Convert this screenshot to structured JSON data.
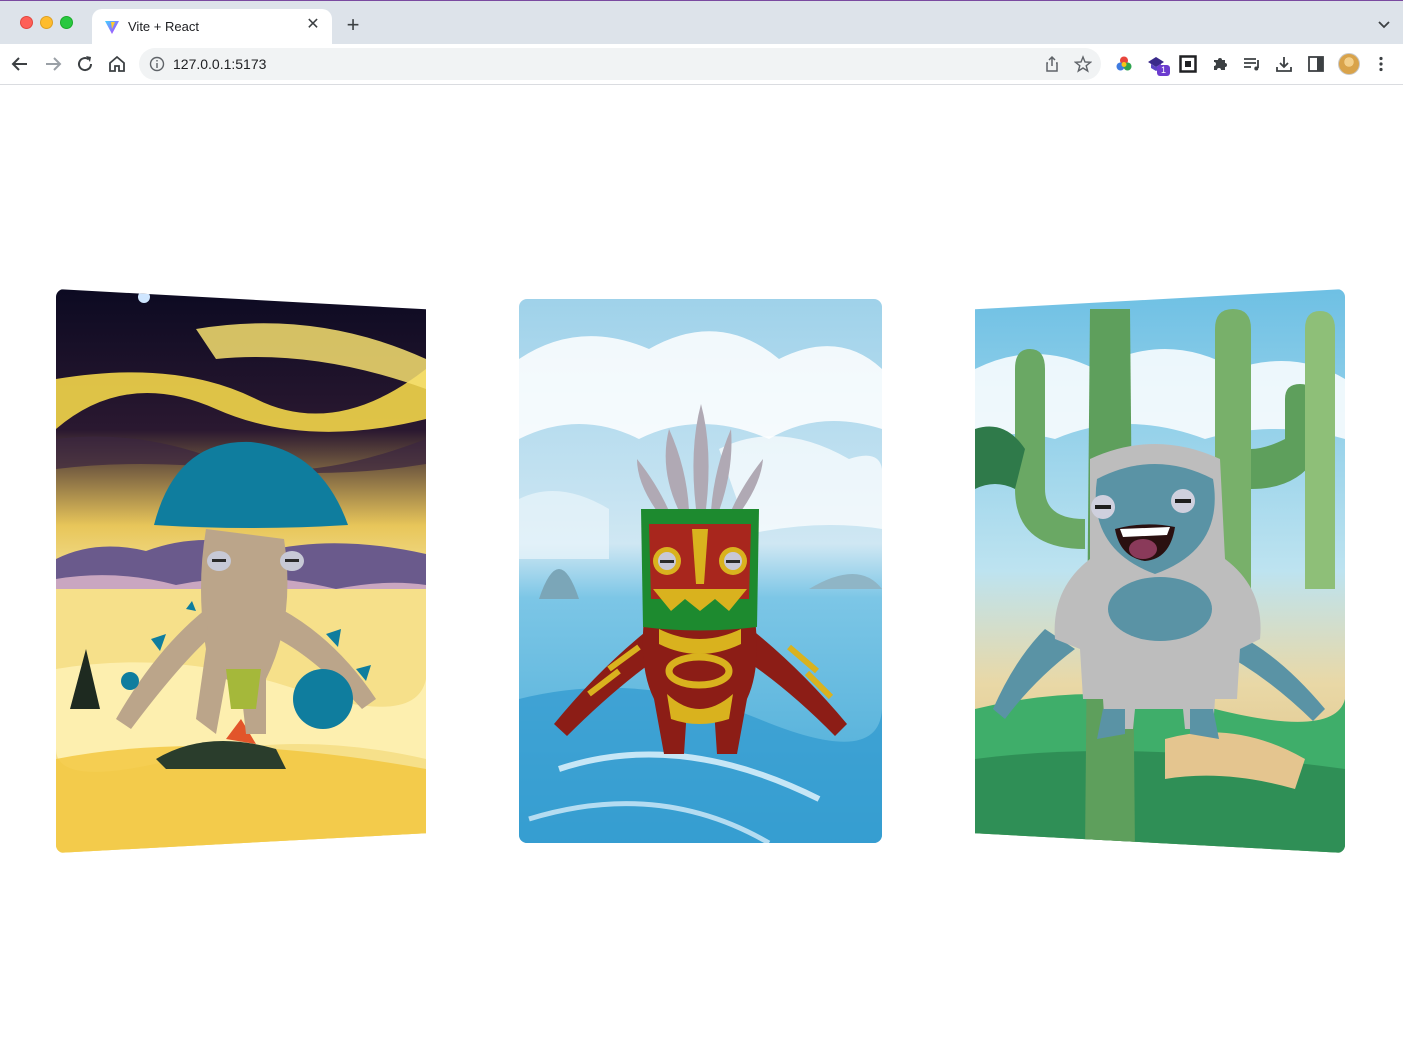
{
  "browser": {
    "tab": {
      "title": "Vite + React",
      "favicon": "vite-logo-icon",
      "close_icon": "close-icon"
    },
    "new_tab_icon": "plus-icon",
    "tab_search_icon": "chevron-down-icon",
    "nav": {
      "back": "arrow-left-icon",
      "forward": "arrow-right-icon",
      "reload": "reload-icon",
      "home": "home-icon"
    },
    "address_bar": {
      "url": "127.0.0.1:5173",
      "info_icon": "info-icon",
      "share_icon": "share-icon",
      "bookmark_icon": "star-icon"
    },
    "extensions": {
      "items": [
        "color-wheel-icon",
        "gem-extension-icon",
        "frame-extension-icon",
        "puzzle-icon",
        "media-queue-icon",
        "download-icon",
        "side-panel-icon"
      ],
      "badge": "1"
    },
    "menu_icon": "kebab-menu-icon",
    "colors": {
      "tab_strip": "#dde3ea",
      "toolbar": "#ffffff",
      "omnibox": "#f1f3f4"
    }
  },
  "cards": [
    {
      "id": "mushroom",
      "scene": "stormy yellow sky beach",
      "character": "mushroom creature",
      "colors": {
        "sky": "#1a0f2e",
        "sand": "#f7e27a",
        "cap": "#0f7d9e",
        "body": "#bfa88b"
      }
    },
    {
      "id": "tiki",
      "scene": "ocean with clouds",
      "character": "tiki mask warrior",
      "colors": {
        "sky": "#8ecbe6",
        "sea": "#5fb9dc",
        "mask": "#1d8a2f",
        "body": "#8c1d16",
        "accent": "#d9b21e"
      }
    },
    {
      "id": "yeti",
      "scene": "cactus desert",
      "character": "blue yeti",
      "colors": {
        "sky": "#7ec6e4",
        "cactus": "#5e9f5c",
        "fur": "#bdbdbd",
        "skin": "#5a93a5"
      }
    }
  ]
}
